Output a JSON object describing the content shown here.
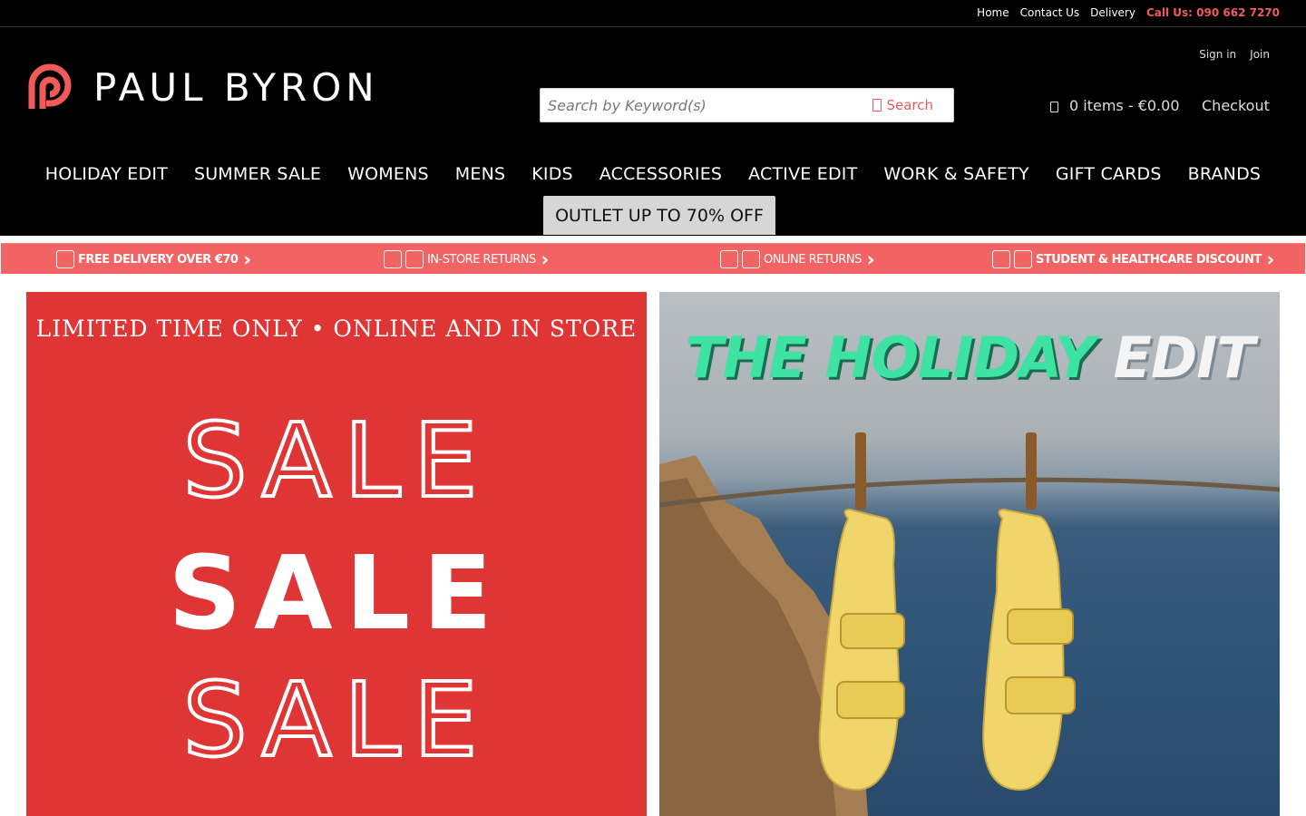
{
  "topbar": {
    "links": [
      "Home",
      "Contact Us",
      "Delivery"
    ],
    "phone": "Call Us: 090 662 7270"
  },
  "header": {
    "logo_text": "PAUL BYRON",
    "signin": "Sign in",
    "join": "Join",
    "search_placeholder": "Search by Keyword(s)",
    "search_button": "Search",
    "cart": "0 items - €0.00",
    "checkout": "Checkout"
  },
  "nav": {
    "items": [
      "HOLIDAY EDIT",
      "SUMMER SALE",
      "WOMENS",
      "MENS",
      "KIDS",
      "ACCESSORIES",
      "ACTIVE EDIT",
      "WORK & SAFETY",
      "GIFT CARDS",
      "BRANDS"
    ],
    "outlet": "OUTLET UP TO 70% OFF"
  },
  "promo": {
    "items": [
      "FREE DELIVERY OVER €70",
      "IN-STORE RETURNS",
      "ONLINE RETURNS",
      "STUDENT & HEALTHCARE DISCOUNT"
    ]
  },
  "banner_left": {
    "top_text": "LIMITED TIME ONLY  •  ONLINE AND IN STORE",
    "sale": "SALE",
    "background": "#e03535"
  },
  "banner_right": {
    "title_a": "THE HOLIDAY",
    "title_b": "EDIT"
  },
  "colors": {
    "accent": "#f25a5a",
    "header_bg": "#000000",
    "promo_bg": "#f26464"
  }
}
